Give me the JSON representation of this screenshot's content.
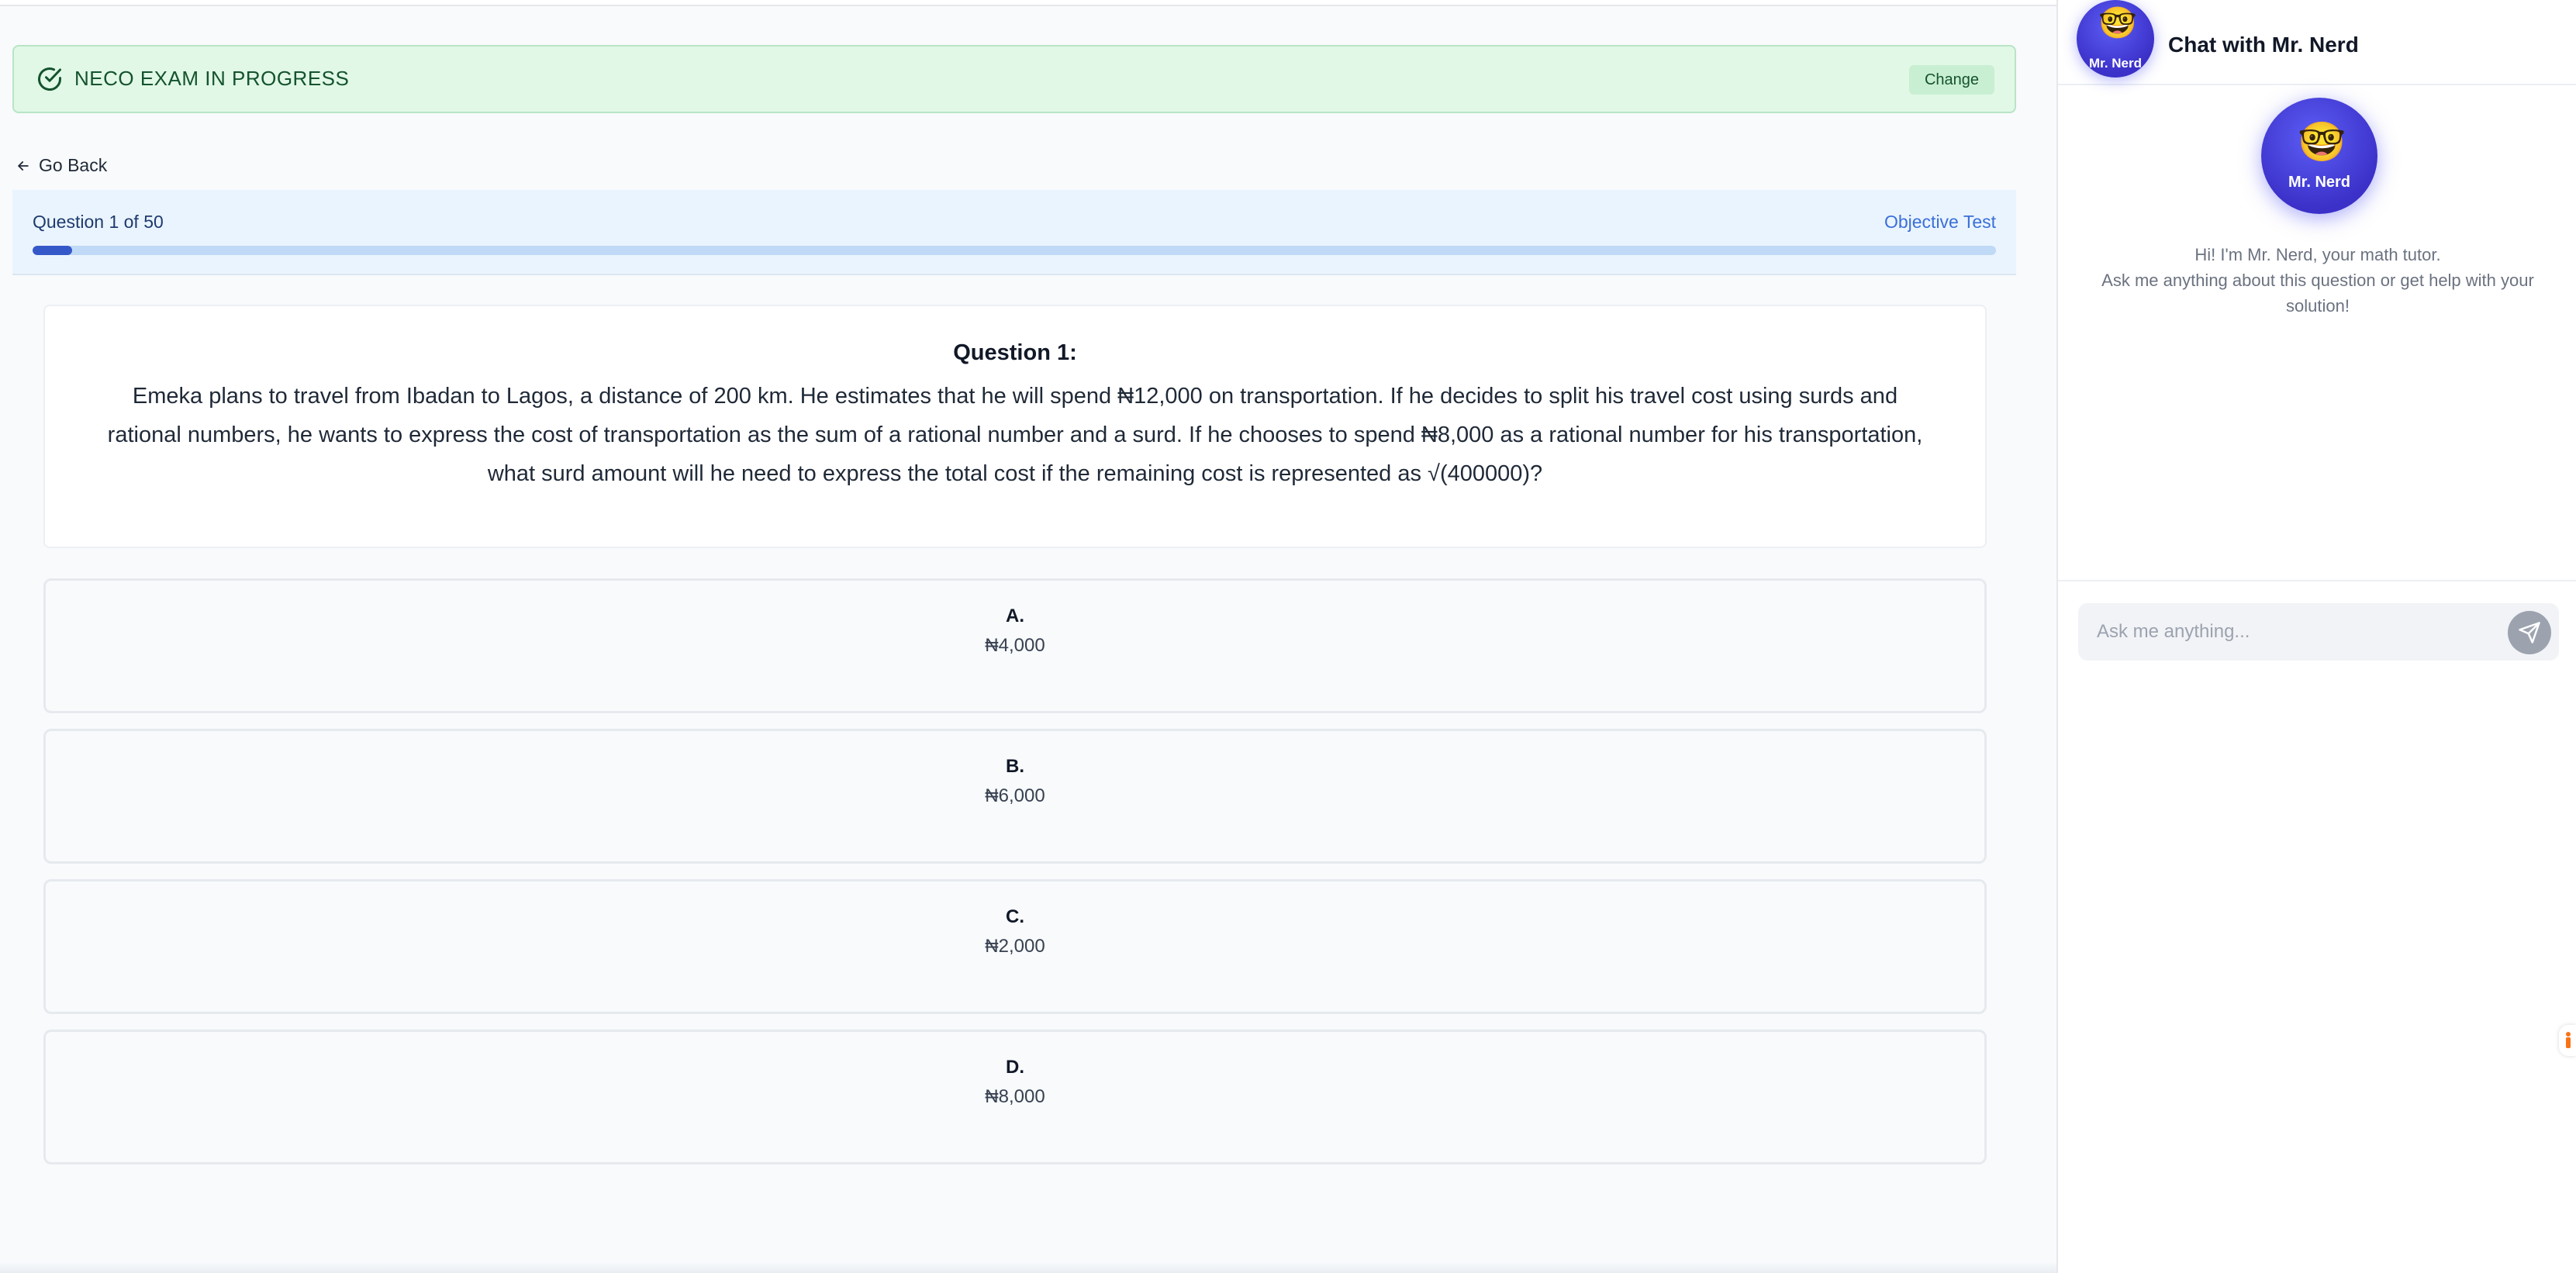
{
  "banner": {
    "status_text": "NECO EXAM IN PROGRESS",
    "change_label": "Change"
  },
  "nav": {
    "go_back_label": "Go Back"
  },
  "progress": {
    "counter_text": "Question 1 of 50",
    "test_type": "Objective Test",
    "current": 1,
    "total": 50
  },
  "question": {
    "title": "Question 1:",
    "text": "Emeka plans to travel from Ibadan to Lagos, a distance of 200 km. He estimates that he will spend ₦12,000 on transportation. If he decides to split his travel cost using surds and rational numbers, he wants to express the cost of transportation as the sum of a rational number and a surd. If he chooses to spend ₦8,000 as a rational number for his transportation, what surd amount will he need to express the total cost if the remaining cost is represented as √(400000)?"
  },
  "options": [
    {
      "letter": "A.",
      "value": "₦4,000"
    },
    {
      "letter": "B.",
      "value": "₦6,000"
    },
    {
      "letter": "C.",
      "value": "₦2,000"
    },
    {
      "letter": "D.",
      "value": "₦8,000"
    }
  ],
  "chat": {
    "title": "Chat with Mr. Nerd",
    "avatar_name": "Mr. Nerd",
    "avatar_emoji": "🤓",
    "intro_line1": "Hi! I'm Mr. Nerd, your math tutor.",
    "intro_line2": "Ask me anything about this question or get help with your solution!",
    "input_placeholder": "Ask me anything..."
  },
  "colors": {
    "accent": "#3558c9",
    "banner_bg": "#e1f8e7",
    "avatar": "#4f46e5"
  },
  "icons": [
    "check-circle-icon",
    "arrow-left-icon",
    "send-icon",
    "accessibility-icon"
  ]
}
